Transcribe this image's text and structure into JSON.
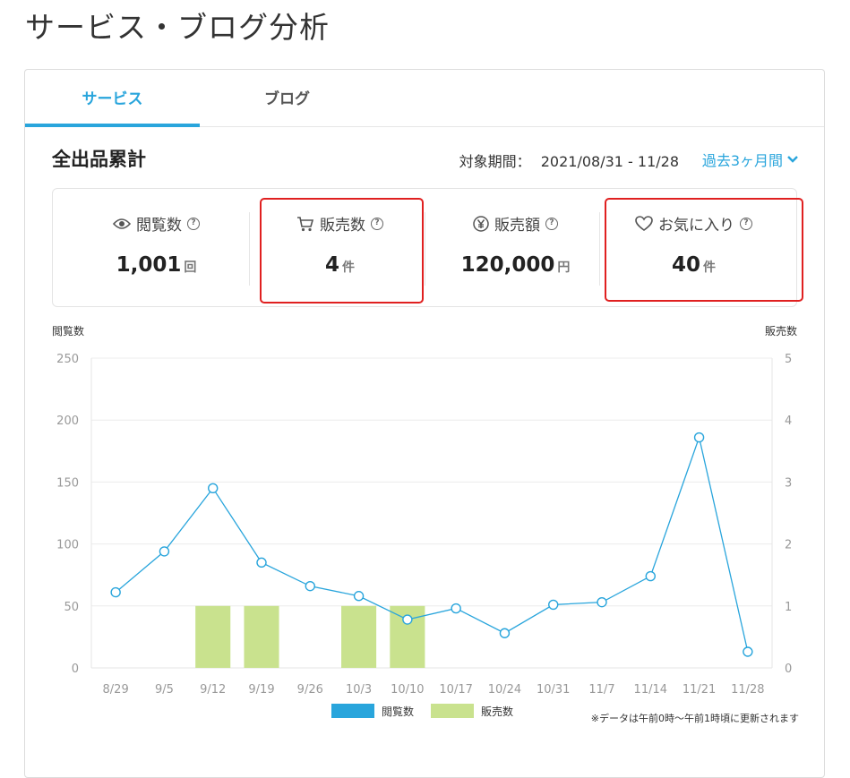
{
  "page": {
    "title": "サービス・ブログ分析"
  },
  "tabs": [
    {
      "label": "サービス",
      "active": true
    },
    {
      "label": "ブログ",
      "active": false
    }
  ],
  "summary": {
    "title": "全出品累計",
    "period_label": "対象期間：",
    "period_value": "2021/08/31 - 11/28",
    "period_select": "過去3ヶ月間"
  },
  "stats": [
    {
      "label": "閲覧数",
      "value": "1,001",
      "unit": "回",
      "icon": "eye-icon"
    },
    {
      "label": "販売数",
      "value": "4",
      "unit": "件",
      "icon": "cart-icon"
    },
    {
      "label": "販売額",
      "value": "120,000",
      "unit": "円",
      "icon": "yen-icon"
    },
    {
      "label": "お気に入り",
      "value": "40",
      "unit": "件",
      "icon": "heart-icon"
    }
  ],
  "colors": {
    "accent": "#29a5dc",
    "bar": "#c9e28e",
    "highlight": "#e02020"
  },
  "chart_data": {
    "type": "bar",
    "categories": [
      "8/29",
      "9/5",
      "9/12",
      "9/19",
      "9/26",
      "10/3",
      "10/10",
      "10/17",
      "10/24",
      "10/31",
      "11/7",
      "11/14",
      "11/21",
      "11/28"
    ],
    "ylabel_left": "閲覧数",
    "ylabel_right": "販売数",
    "ylim_left": [
      0,
      250
    ],
    "ylim_right": [
      0,
      5
    ],
    "yticks_left": [
      "0",
      "50",
      "100",
      "150",
      "200",
      "250"
    ],
    "yticks_right": [
      "0",
      "1",
      "2",
      "3",
      "4",
      "5"
    ],
    "series": [
      {
        "name": "閲覧数",
        "type": "line",
        "axis": "left",
        "color": "#29a5dc",
        "values": [
          61,
          94,
          145,
          85,
          66,
          58,
          39,
          48,
          28,
          51,
          53,
          74,
          186,
          13
        ]
      },
      {
        "name": "販売数",
        "type": "bar",
        "axis": "right",
        "color": "#c9e28e",
        "values": [
          0,
          0,
          1,
          1,
          0,
          1,
          1,
          0,
          0,
          0,
          0,
          0,
          0,
          0
        ]
      }
    ],
    "legend_position": "bottom",
    "note": "※データは午前0時～午前1時頃に更新されます"
  }
}
